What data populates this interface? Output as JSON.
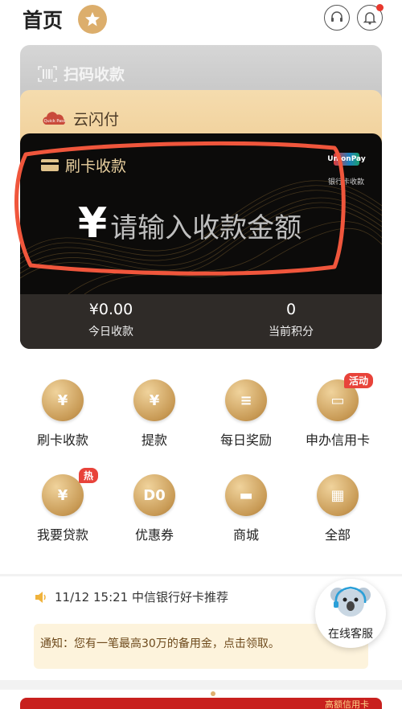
{
  "header": {
    "title": "首页"
  },
  "cards": {
    "scan_label": "扫码收款",
    "cloud_label": "云闪付",
    "cloud_logo_text": "Quick Pass",
    "main_label": "刷卡收款",
    "unionpay_label": "UnionPay",
    "unionpay_caption": "银行卡收款",
    "amount_symbol": "¥",
    "amount_placeholder": "请输入收款金额",
    "today_value": "¥0.00",
    "today_label": "今日收款",
    "points_value": "0",
    "points_label": "当前积分"
  },
  "grid": [
    {
      "label": "刷卡收款",
      "icon": "card-swipe-icon",
      "glyph": "¥"
    },
    {
      "label": "提款",
      "icon": "money-bag-icon",
      "glyph": "¥"
    },
    {
      "label": "每日奖励",
      "icon": "reward-document-icon",
      "glyph": "≡"
    },
    {
      "label": "申办信用卡",
      "icon": "credit-card-icon",
      "glyph": "▭",
      "tag": "活动"
    },
    {
      "label": "我要贷款",
      "icon": "loan-icon",
      "glyph": "¥",
      "tag": "热"
    },
    {
      "label": "优惠券",
      "icon": "coupon-icon",
      "glyph": "D0"
    },
    {
      "label": "商城",
      "icon": "shopping-mall-icon",
      "glyph": "▬"
    },
    {
      "label": "全部",
      "icon": "all-grid-icon",
      "glyph": "▦"
    }
  ],
  "news": {
    "headline": "11/12 15:21 中信银行好卡推荐"
  },
  "notice": {
    "text": "通知：您有一笔最高30万的备用金，点击领取。"
  },
  "service": {
    "label": "在线客服"
  },
  "banner": {
    "text": "高额信用卡"
  },
  "colors": {
    "gold": "#dcae6c",
    "annotation_red": "#f0563c",
    "dark_card": "#0c0b0a",
    "badge_red": "#e8433a"
  }
}
